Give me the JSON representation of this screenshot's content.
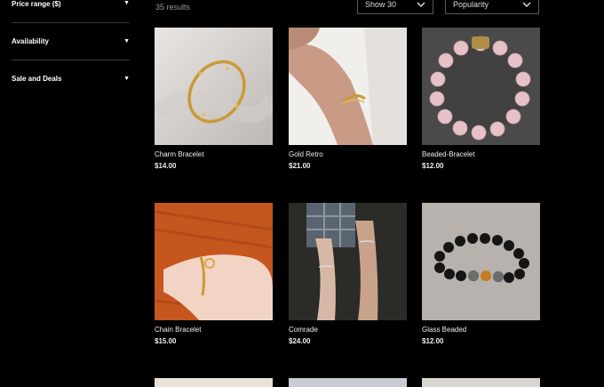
{
  "filters": [
    {
      "label": "Price range ($)"
    },
    {
      "label": "Availability"
    },
    {
      "label": "Sale and Deals"
    }
  ],
  "toolbar": {
    "results": "35 results",
    "show_label": "Show 30",
    "sort_label": "Popularity"
  },
  "products": [
    {
      "name": "Charm Bracelet",
      "price": "$14.00"
    },
    {
      "name": "Gold Retro",
      "price": "$21.00"
    },
    {
      "name": "Beaded-Bracelet",
      "price": "$12.00"
    },
    {
      "name": "Chain Bracelet",
      "price": "$15.00"
    },
    {
      "name": "Comrade",
      "price": "$24.00"
    },
    {
      "name": "Glass Beaded",
      "price": "$12.00"
    }
  ],
  "icons": {
    "chevron": "chevron-down-icon"
  }
}
